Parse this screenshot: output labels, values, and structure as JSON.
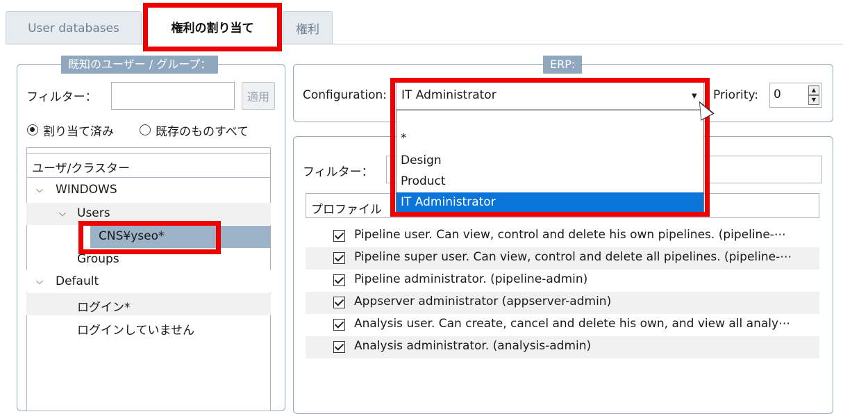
{
  "tabs": [
    {
      "label": "User databases",
      "active": false
    },
    {
      "label": "権利の割り当て",
      "active": true
    },
    {
      "label": "権利",
      "active": false
    }
  ],
  "left_panel": {
    "legend": "既知のユーザー / グループ：",
    "filter_label": "フィルター：",
    "filter_value": "",
    "apply_button": "適用",
    "radio_assigned": "割り当て済み",
    "radio_all": "既存のものすべて",
    "tree_header": "ユーザ/クラスター",
    "tree": [
      {
        "label": "WINDOWS",
        "expanded": true
      },
      {
        "label": "Users",
        "expanded": true
      },
      {
        "label": "CNS¥yseo*",
        "selected": true
      },
      {
        "label": "Groups"
      },
      {
        "label": "Default",
        "expanded": true
      },
      {
        "label": "ログイン*"
      },
      {
        "label": "ログインしていません"
      }
    ]
  },
  "right_panel": {
    "legend": "ERP:",
    "configuration_label": "Configuration:",
    "configuration_value": "IT Administrator",
    "dropdown_options": [
      "*",
      "Design",
      "Product",
      "IT Administrator"
    ],
    "selected_option_index": 3,
    "priority_label": "Priority:",
    "priority_value": "0",
    "filter_label": "フィルター：",
    "profile_header": "プロファイル",
    "permissions": [
      {
        "label": "Pipeline user. Can view, control and delete his own pipelines. (pipeline-⋯",
        "checked": true
      },
      {
        "label": "Pipeline super user. Can view, control and delete all pipelines. (pipeline-⋯",
        "checked": true
      },
      {
        "label": "Pipeline administrator. (pipeline-admin)",
        "checked": true
      },
      {
        "label": "Appserver administrator (appserver-admin)",
        "checked": true
      },
      {
        "label": "Analysis user. Can create, cancel and delete his own, and view all analy⋯",
        "checked": true
      },
      {
        "label": "Analysis administrator. (analysis-admin)",
        "checked": true
      }
    ]
  },
  "colors": {
    "highlight_red": "#ee0000",
    "selection_blue": "#0a74d9",
    "legend_bg": "#8fa7bf",
    "tree_selected": "#9cb2c6"
  },
  "icons": {
    "expand": "chevron-down-icon",
    "combo": "dropdown-arrow-icon",
    "spin": "spinner-icon",
    "check": "checkbox-checked-icon"
  }
}
